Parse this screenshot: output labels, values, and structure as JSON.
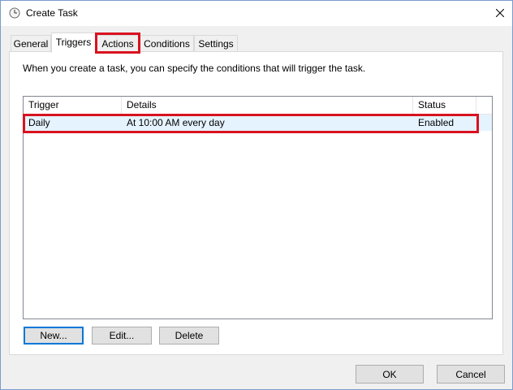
{
  "window": {
    "title": "Create Task",
    "icon": "clock-icon",
    "close_icon": "close-icon"
  },
  "tabs": [
    {
      "label": "General",
      "active": false
    },
    {
      "label": "Triggers",
      "active": true
    },
    {
      "label": "Actions",
      "active": false,
      "highlighted": true
    },
    {
      "label": "Conditions",
      "active": false
    },
    {
      "label": "Settings",
      "active": false
    }
  ],
  "triggers_panel": {
    "description": "When you create a task, you can specify the conditions that will trigger the task.",
    "columns": [
      "Trigger",
      "Details",
      "Status"
    ],
    "rows": [
      {
        "trigger": "Daily",
        "details": "At 10:00 AM every day",
        "status": "Enabled",
        "selected": true,
        "highlighted": true
      }
    ],
    "buttons": {
      "new": "New...",
      "edit": "Edit...",
      "delete": "Delete"
    }
  },
  "footer": {
    "ok": "OK",
    "cancel": "Cancel"
  },
  "colors": {
    "highlight_border": "#d9121f",
    "selection_bg": "#e5f3ff",
    "default_button_border": "#0078d7"
  }
}
